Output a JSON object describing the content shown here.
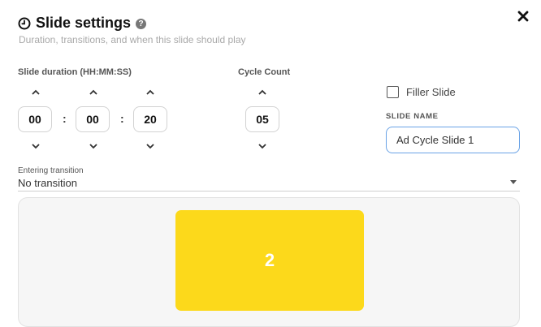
{
  "dialog": {
    "title": "Slide settings",
    "help_glyph": "?",
    "subtitle": "Duration, transitions, and when this slide should play"
  },
  "duration": {
    "label": "Slide duration (HH:MM:SS)",
    "hours": "00",
    "minutes": "00",
    "seconds": "20",
    "separator": ":"
  },
  "cycle": {
    "label": "Cycle Count",
    "value": "05"
  },
  "filler": {
    "label": "Filler Slide",
    "checked": false
  },
  "slide_name": {
    "label": "SLIDE NAME",
    "value": "Ad Cycle Slide 1"
  },
  "transition": {
    "label": "Entering transition",
    "value": "No transition"
  },
  "preview": {
    "slide_number": "2",
    "slide_color": "#fcd91b"
  },
  "icons": {
    "title": "clock-icon",
    "help": "help-icon",
    "close": "close-icon",
    "increment": "chevron-up-icon",
    "decrement": "chevron-down-icon",
    "dropdown": "caret-down-icon"
  },
  "colors": {
    "input_focus_border": "#6aa3e6",
    "preview_bg": "#f6f6f6"
  }
}
